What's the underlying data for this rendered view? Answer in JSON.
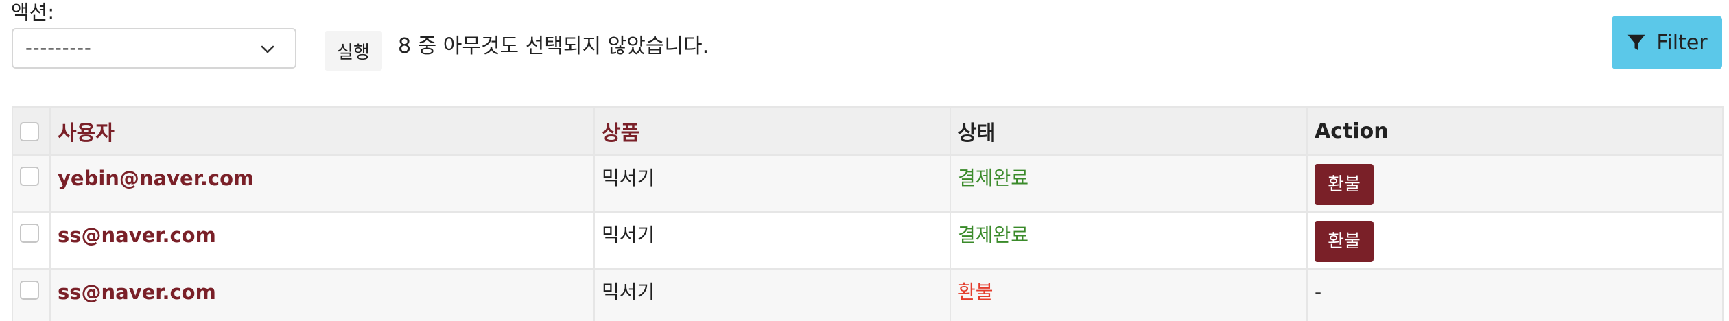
{
  "actions": {
    "label": "액션:",
    "select_value": "---------",
    "run_label": "실행",
    "selection_status": "8 중 아무것도 선택되지 않았습니다."
  },
  "filter": {
    "label": "Filter",
    "icon": "filter-icon",
    "color": "#5bc8e9"
  },
  "table": {
    "headers": {
      "user": "사용자",
      "product": "상품",
      "status": "상태",
      "action": "Action"
    },
    "rows": [
      {
        "user": "yebin@naver.com",
        "product": "믹서기",
        "status": "결제완료",
        "action": "환불"
      },
      {
        "user": "ss@naver.com",
        "product": "믹서기",
        "status": "결제완료",
        "action": "환불"
      },
      {
        "user": "ss@naver.com",
        "product": "믹서기",
        "status": "환불",
        "action": "-"
      }
    ]
  },
  "colors": {
    "link": "#7a2028",
    "paid": "#3a8a2a",
    "refunded": "#e43c2c",
    "refund_button": "#7a2028"
  }
}
